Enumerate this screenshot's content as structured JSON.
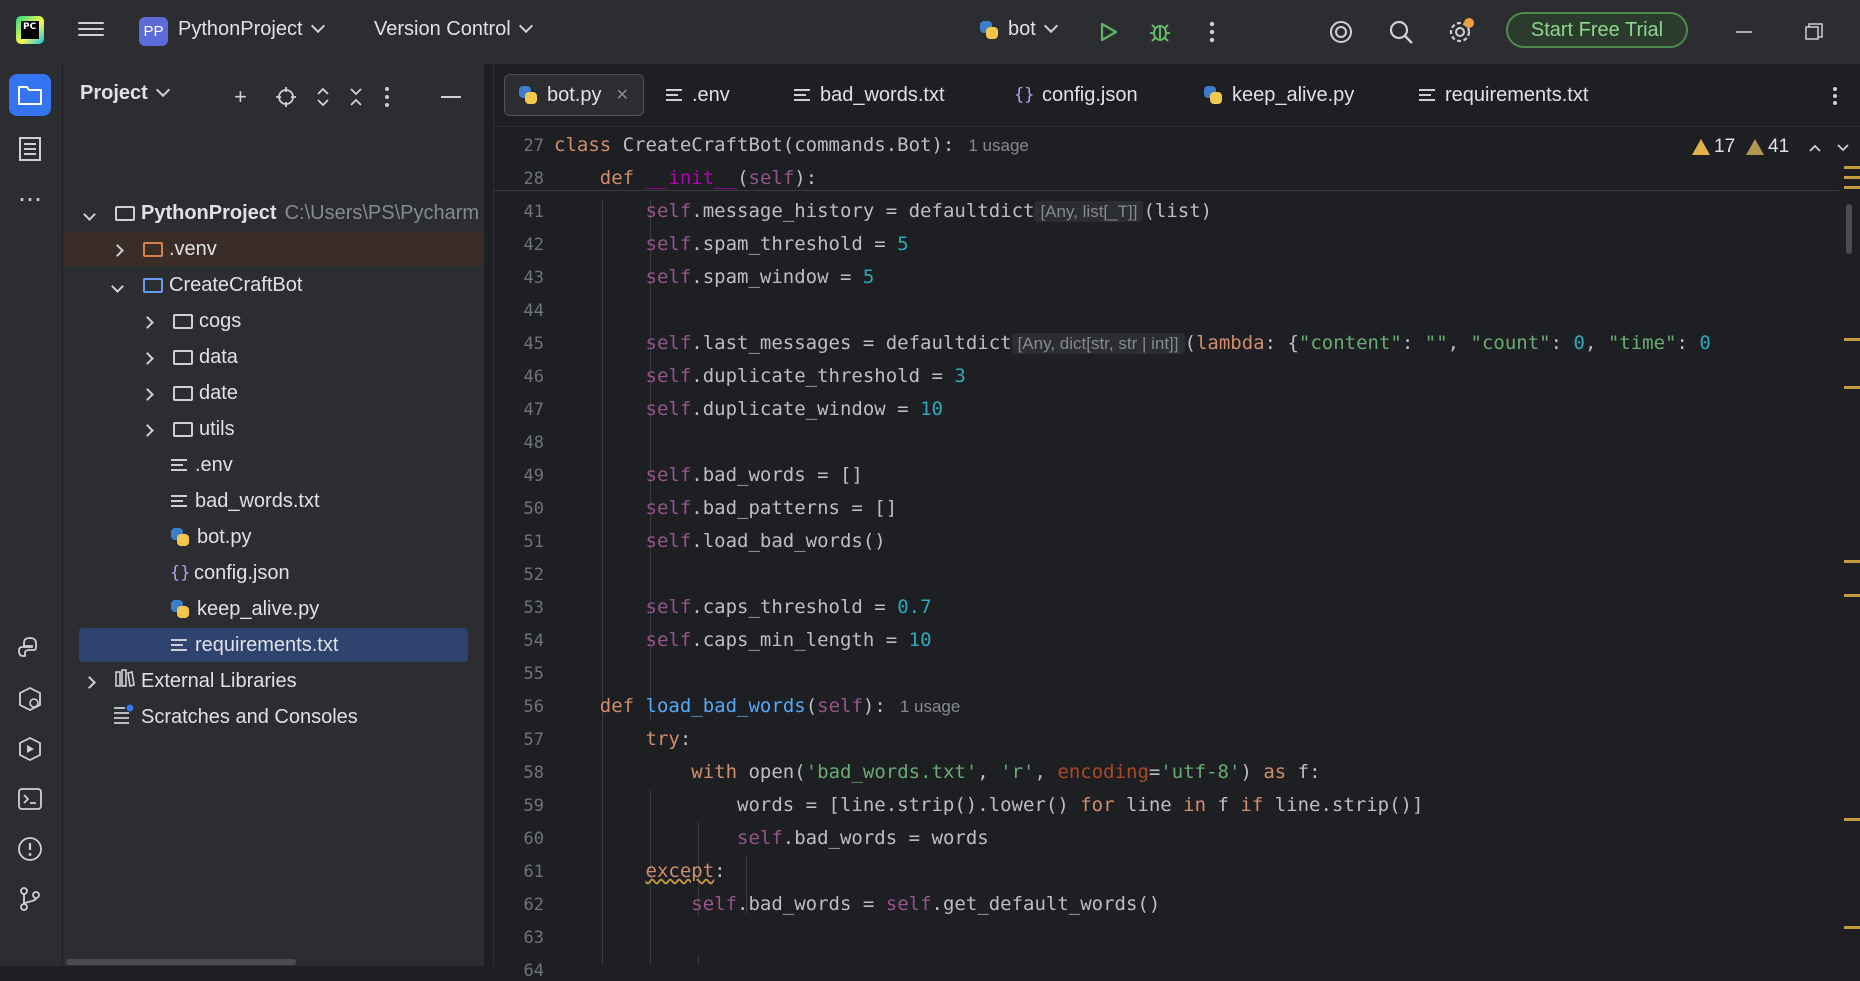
{
  "titlebar": {
    "project_initials": "PP",
    "project_name": "PythonProject",
    "version_control": "Version Control",
    "run_config": "bot",
    "trial_button": "Start Free Trial"
  },
  "project_panel": {
    "title": "Project",
    "tree": [
      {
        "label": "PythonProject",
        "extra": "C:\\Users\\PS\\Pycharm",
        "level": 0,
        "icon": "folder-icon",
        "expanded": true
      },
      {
        "label": ".venv",
        "level": 1,
        "icon": "folder-orange-icon",
        "expanded": false
      },
      {
        "label": "CreateCraftBot",
        "level": 1,
        "icon": "folder-blue-icon",
        "expanded": true
      },
      {
        "label": "cogs",
        "level": 2,
        "icon": "package-folder-icon",
        "expanded": false
      },
      {
        "label": "data",
        "level": 2,
        "icon": "folder-icon",
        "expanded": false
      },
      {
        "label": "date",
        "level": 2,
        "icon": "folder-icon",
        "expanded": false
      },
      {
        "label": "utils",
        "level": 2,
        "icon": "package-folder-icon",
        "expanded": false
      },
      {
        "label": ".env",
        "level": 3,
        "icon": "text-file-icon"
      },
      {
        "label": "bad_words.txt",
        "level": 3,
        "icon": "text-file-icon"
      },
      {
        "label": "bot.py",
        "level": 3,
        "icon": "python-file-icon"
      },
      {
        "label": "config.json",
        "level": 3,
        "icon": "json-file-icon"
      },
      {
        "label": "keep_alive.py",
        "level": 3,
        "icon": "python-file-icon"
      },
      {
        "label": "requirements.txt",
        "level": 3,
        "icon": "text-file-icon",
        "selected": true
      },
      {
        "label": "External Libraries",
        "level": 0,
        "icon": "libraries-icon",
        "expanded": false
      },
      {
        "label": "Scratches and Consoles",
        "level": 0,
        "icon": "scratches-icon"
      }
    ]
  },
  "tabs": [
    {
      "label": "bot.py",
      "icon": "python-file-icon",
      "active": true
    },
    {
      "label": ".env",
      "icon": "text-file-icon"
    },
    {
      "label": "bad_words.txt",
      "icon": "text-file-icon"
    },
    {
      "label": "config.json",
      "icon": "json-file-icon"
    },
    {
      "label": "keep_alive.py",
      "icon": "python-file-icon"
    },
    {
      "label": "requirements.txt",
      "icon": "text-file-icon"
    }
  ],
  "inspections": {
    "warnings": "17",
    "weak_warnings": "41"
  },
  "editor": {
    "line_numbers": [
      "27",
      "28",
      "41",
      "42",
      "43",
      "44",
      "45",
      "46",
      "47",
      "48",
      "49",
      "50",
      "51",
      "52",
      "53",
      "54",
      "55",
      "56",
      "57",
      "58",
      "59",
      "60",
      "61",
      "62",
      "63",
      "64"
    ],
    "usage_1": "1 usage",
    "usage_2": "1 usage",
    "hint_1": "[Any, list[_T]]",
    "hint_2": "[Any, dict[str, str | int]]"
  },
  "colors": {
    "accent": "#3574f0",
    "selection": "#2e436e",
    "warning": "#e0b34c",
    "trial": "#4e8b4f"
  }
}
